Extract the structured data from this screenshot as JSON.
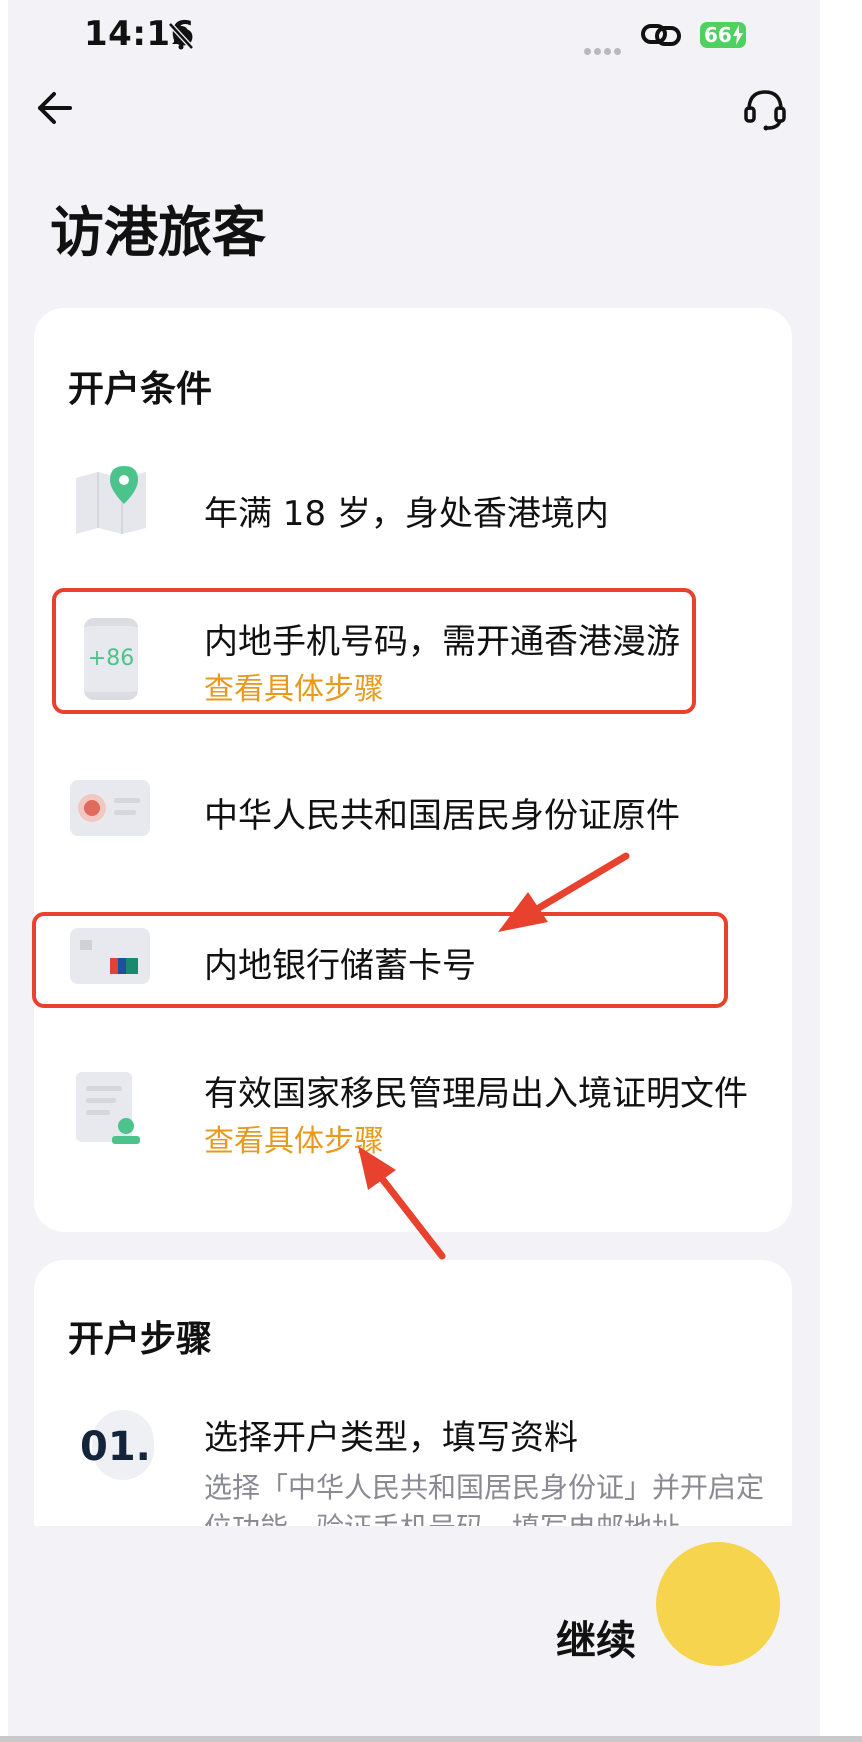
{
  "status_bar": {
    "time": "14:16",
    "battery": "66"
  },
  "header": {
    "title": "访港旅客"
  },
  "conditions": {
    "title": "开户条件",
    "items": [
      {
        "text": "年满 18 岁，身处香港境内",
        "icon": "map-pin-icon"
      },
      {
        "text": "内地手机号码，需开通香港漫游",
        "link": "查看具体步骤",
        "icon": "phone-plus86-icon",
        "icon_text": "+86"
      },
      {
        "text": "中华人民共和国居民身份证原件",
        "icon": "id-card-icon"
      },
      {
        "text": "内地银行储蓄卡号",
        "icon": "unionpay-card-icon"
      },
      {
        "text": "有效国家移民管理局出入境证明文件",
        "link": "查看具体步骤",
        "icon": "certificate-icon"
      }
    ]
  },
  "steps": {
    "title": "开户步骤",
    "items": [
      {
        "number": "01.",
        "title": "选择开户类型，填写资料",
        "desc": "选择「中华人民共和国居民身份证」并开启定位功能，验证手机号码，填写电邮地址"
      }
    ]
  },
  "footer": {
    "continue_label": "继续"
  },
  "colors": {
    "accent": "#f6d44e",
    "link": "#e79a1e",
    "annotation": "#e8412e",
    "pin": "#4cc38a"
  }
}
